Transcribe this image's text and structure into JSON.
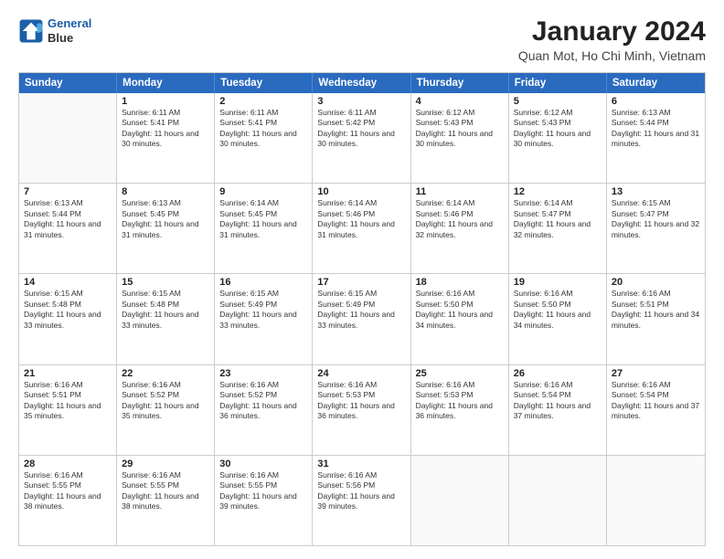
{
  "logo": {
    "line1": "General",
    "line2": "Blue"
  },
  "title": "January 2024",
  "subtitle": "Quan Mot, Ho Chi Minh, Vietnam",
  "days": [
    "Sunday",
    "Monday",
    "Tuesday",
    "Wednesday",
    "Thursday",
    "Friday",
    "Saturday"
  ],
  "weeks": [
    [
      {
        "day": "",
        "sunrise": "",
        "sunset": "",
        "daylight": ""
      },
      {
        "day": "1",
        "sunrise": "Sunrise: 6:11 AM",
        "sunset": "Sunset: 5:41 PM",
        "daylight": "Daylight: 11 hours and 30 minutes."
      },
      {
        "day": "2",
        "sunrise": "Sunrise: 6:11 AM",
        "sunset": "Sunset: 5:41 PM",
        "daylight": "Daylight: 11 hours and 30 minutes."
      },
      {
        "day": "3",
        "sunrise": "Sunrise: 6:11 AM",
        "sunset": "Sunset: 5:42 PM",
        "daylight": "Daylight: 11 hours and 30 minutes."
      },
      {
        "day": "4",
        "sunrise": "Sunrise: 6:12 AM",
        "sunset": "Sunset: 5:43 PM",
        "daylight": "Daylight: 11 hours and 30 minutes."
      },
      {
        "day": "5",
        "sunrise": "Sunrise: 6:12 AM",
        "sunset": "Sunset: 5:43 PM",
        "daylight": "Daylight: 11 hours and 30 minutes."
      },
      {
        "day": "6",
        "sunrise": "Sunrise: 6:13 AM",
        "sunset": "Sunset: 5:44 PM",
        "daylight": "Daylight: 11 hours and 31 minutes."
      }
    ],
    [
      {
        "day": "7",
        "sunrise": "Sunrise: 6:13 AM",
        "sunset": "Sunset: 5:44 PM",
        "daylight": "Daylight: 11 hours and 31 minutes."
      },
      {
        "day": "8",
        "sunrise": "Sunrise: 6:13 AM",
        "sunset": "Sunset: 5:45 PM",
        "daylight": "Daylight: 11 hours and 31 minutes."
      },
      {
        "day": "9",
        "sunrise": "Sunrise: 6:14 AM",
        "sunset": "Sunset: 5:45 PM",
        "daylight": "Daylight: 11 hours and 31 minutes."
      },
      {
        "day": "10",
        "sunrise": "Sunrise: 6:14 AM",
        "sunset": "Sunset: 5:46 PM",
        "daylight": "Daylight: 11 hours and 31 minutes."
      },
      {
        "day": "11",
        "sunrise": "Sunrise: 6:14 AM",
        "sunset": "Sunset: 5:46 PM",
        "daylight": "Daylight: 11 hours and 32 minutes."
      },
      {
        "day": "12",
        "sunrise": "Sunrise: 6:14 AM",
        "sunset": "Sunset: 5:47 PM",
        "daylight": "Daylight: 11 hours and 32 minutes."
      },
      {
        "day": "13",
        "sunrise": "Sunrise: 6:15 AM",
        "sunset": "Sunset: 5:47 PM",
        "daylight": "Daylight: 11 hours and 32 minutes."
      }
    ],
    [
      {
        "day": "14",
        "sunrise": "Sunrise: 6:15 AM",
        "sunset": "Sunset: 5:48 PM",
        "daylight": "Daylight: 11 hours and 33 minutes."
      },
      {
        "day": "15",
        "sunrise": "Sunrise: 6:15 AM",
        "sunset": "Sunset: 5:48 PM",
        "daylight": "Daylight: 11 hours and 33 minutes."
      },
      {
        "day": "16",
        "sunrise": "Sunrise: 6:15 AM",
        "sunset": "Sunset: 5:49 PM",
        "daylight": "Daylight: 11 hours and 33 minutes."
      },
      {
        "day": "17",
        "sunrise": "Sunrise: 6:15 AM",
        "sunset": "Sunset: 5:49 PM",
        "daylight": "Daylight: 11 hours and 33 minutes."
      },
      {
        "day": "18",
        "sunrise": "Sunrise: 6:16 AM",
        "sunset": "Sunset: 5:50 PM",
        "daylight": "Daylight: 11 hours and 34 minutes."
      },
      {
        "day": "19",
        "sunrise": "Sunrise: 6:16 AM",
        "sunset": "Sunset: 5:50 PM",
        "daylight": "Daylight: 11 hours and 34 minutes."
      },
      {
        "day": "20",
        "sunrise": "Sunrise: 6:16 AM",
        "sunset": "Sunset: 5:51 PM",
        "daylight": "Daylight: 11 hours and 34 minutes."
      }
    ],
    [
      {
        "day": "21",
        "sunrise": "Sunrise: 6:16 AM",
        "sunset": "Sunset: 5:51 PM",
        "daylight": "Daylight: 11 hours and 35 minutes."
      },
      {
        "day": "22",
        "sunrise": "Sunrise: 6:16 AM",
        "sunset": "Sunset: 5:52 PM",
        "daylight": "Daylight: 11 hours and 35 minutes."
      },
      {
        "day": "23",
        "sunrise": "Sunrise: 6:16 AM",
        "sunset": "Sunset: 5:52 PM",
        "daylight": "Daylight: 11 hours and 36 minutes."
      },
      {
        "day": "24",
        "sunrise": "Sunrise: 6:16 AM",
        "sunset": "Sunset: 5:53 PM",
        "daylight": "Daylight: 11 hours and 36 minutes."
      },
      {
        "day": "25",
        "sunrise": "Sunrise: 6:16 AM",
        "sunset": "Sunset: 5:53 PM",
        "daylight": "Daylight: 11 hours and 36 minutes."
      },
      {
        "day": "26",
        "sunrise": "Sunrise: 6:16 AM",
        "sunset": "Sunset: 5:54 PM",
        "daylight": "Daylight: 11 hours and 37 minutes."
      },
      {
        "day": "27",
        "sunrise": "Sunrise: 6:16 AM",
        "sunset": "Sunset: 5:54 PM",
        "daylight": "Daylight: 11 hours and 37 minutes."
      }
    ],
    [
      {
        "day": "28",
        "sunrise": "Sunrise: 6:16 AM",
        "sunset": "Sunset: 5:55 PM",
        "daylight": "Daylight: 11 hours and 38 minutes."
      },
      {
        "day": "29",
        "sunrise": "Sunrise: 6:16 AM",
        "sunset": "Sunset: 5:55 PM",
        "daylight": "Daylight: 11 hours and 38 minutes."
      },
      {
        "day": "30",
        "sunrise": "Sunrise: 6:16 AM",
        "sunset": "Sunset: 5:55 PM",
        "daylight": "Daylight: 11 hours and 39 minutes."
      },
      {
        "day": "31",
        "sunrise": "Sunrise: 6:16 AM",
        "sunset": "Sunset: 5:56 PM",
        "daylight": "Daylight: 11 hours and 39 minutes."
      },
      {
        "day": "",
        "sunrise": "",
        "sunset": "",
        "daylight": ""
      },
      {
        "day": "",
        "sunrise": "",
        "sunset": "",
        "daylight": ""
      },
      {
        "day": "",
        "sunrise": "",
        "sunset": "",
        "daylight": ""
      }
    ]
  ]
}
